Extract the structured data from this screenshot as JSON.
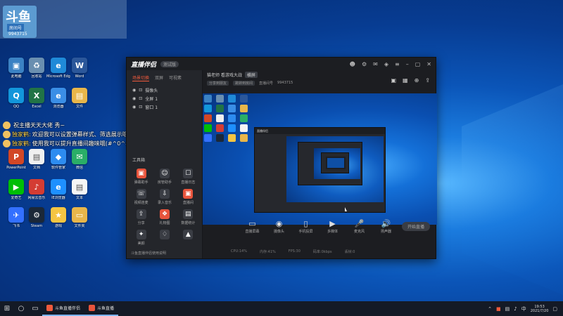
{
  "desktop": {
    "corner_widget": {
      "logo_text": "斗鱼",
      "room_label": "房间号",
      "room_number": "9943715"
    },
    "icons": [
      {
        "label": "此电脑",
        "color": "#3b82c4",
        "glyph": "▣"
      },
      {
        "label": "回收站",
        "color": "#6a8fb0",
        "glyph": "♻"
      },
      {
        "label": "Microsoft Edge",
        "color": "#1f8ad8",
        "glyph": "e"
      },
      {
        "label": "Word",
        "color": "#2b579a",
        "glyph": "W"
      },
      {
        "label": "QQ",
        "color": "#1296db",
        "glyph": "Q"
      },
      {
        "label": "Excel",
        "color": "#217346",
        "glyph": "X"
      },
      {
        "label": "浏览器",
        "color": "#3a8ee6",
        "glyph": "e"
      },
      {
        "label": "文件",
        "color": "#e8b64a",
        "glyph": "▤"
      },
      {
        "label": "PowerPoint",
        "color": "#d24726",
        "glyph": "P"
      },
      {
        "label": "文档",
        "color": "#f0f0f0",
        "glyph": "▤"
      },
      {
        "label": "软件管家",
        "color": "#2d8cf0",
        "glyph": "◆"
      },
      {
        "label": "微信",
        "color": "#2aae67",
        "glyph": "✉"
      },
      {
        "label": "爱奇艺",
        "color": "#00be06",
        "glyph": "▶"
      },
      {
        "label": "网易云音乐",
        "color": "#d43c33",
        "glyph": "♪"
      },
      {
        "label": "IE浏览器",
        "color": "#1e90ff",
        "glyph": "e"
      },
      {
        "label": "文本",
        "color": "#f5f5f5",
        "glyph": "▤"
      },
      {
        "label": "飞书",
        "color": "#3370ff",
        "glyph": "✈"
      },
      {
        "label": "Steam",
        "color": "#1b2838",
        "glyph": "⚙"
      },
      {
        "label": "游戏",
        "color": "#f5c542",
        "glyph": "★"
      },
      {
        "label": "文件夹",
        "color": "#e8b64a",
        "glyph": "▭"
      }
    ]
  },
  "chat": [
    {
      "name": "",
      "text": "祝主播天天大佬 秀~"
    },
    {
      "name": "独家鹤:",
      "text": "欢迎我可以设置弹幕样式、筛选展示哦~"
    },
    {
      "name": "独家鹤:",
      "text": "使用我可以提升直播间趣味哦(#^0^#)"
    }
  ],
  "app": {
    "brand": "直播伴侣",
    "version": "测试版",
    "tabs": [
      "场景切换",
      "双屏",
      "可视素"
    ],
    "scenes": [
      "摄像头",
      "全屏 1",
      "窗口 1"
    ],
    "tools_title": "工具箱",
    "tools": [
      {
        "label": "弹幕助手",
        "color": "#e8543c",
        "glyph": "▣"
      },
      {
        "label": "房管助手",
        "color": "#3a3d44",
        "glyph": "☺"
      },
      {
        "label": "直播日志",
        "color": "#3a3d44",
        "glyph": "☐"
      },
      {
        "label": "视频连麦",
        "color": "#3a3d44",
        "glyph": "☏"
      },
      {
        "label": "录入音乐",
        "color": "#3a3d44",
        "glyph": "⇩"
      },
      {
        "label": "直播间",
        "color": "#e8543c",
        "glyph": "▣"
      },
      {
        "label": "分享",
        "color": "#3a3d44",
        "glyph": "⇪"
      },
      {
        "label": "礼物图",
        "color": "#e8543c",
        "glyph": "❖"
      },
      {
        "label": "数据统计",
        "color": "#3a3d44",
        "glyph": "▤"
      },
      {
        "label": "美颜",
        "color": "#3a3d44",
        "glyph": "✦"
      },
      {
        "label": "",
        "color": "#3a3d44",
        "glyph": "♢"
      },
      {
        "label": "",
        "color": "#3a3d44",
        "glyph": "▲"
      }
    ],
    "sidebar_footer": "斗鱼直播伴侣使用说明",
    "main_title": "猫老师 看游戏大战",
    "main_title_tag": "横屏",
    "sub_items": [
      "分享到朋友",
      "跳转到房间",
      "直播间号",
      "9943715"
    ],
    "controls": [
      {
        "label": "直播屏幕",
        "glyph": "▭"
      },
      {
        "label": "摄像头",
        "glyph": "◉"
      },
      {
        "label": "手机投屏",
        "glyph": "▯"
      },
      {
        "label": "多媒体",
        "glyph": "▶"
      },
      {
        "label": "麦克风",
        "glyph": "🎤"
      },
      {
        "label": "扬声器",
        "glyph": "🔊"
      }
    ],
    "go_live_label": "开始直播",
    "status": [
      "CPU:14%",
      "内存:41%",
      "FPS:30",
      "码率:0kbps",
      "丢帧:0"
    ]
  },
  "taskbar": {
    "apps": [
      {
        "label": "斗鱼直播伴侣",
        "color": "#f05a3c"
      },
      {
        "label": "斗鱼直播",
        "color": "#e8543c"
      }
    ],
    "time": "19:53",
    "date": "2021/7/20"
  }
}
